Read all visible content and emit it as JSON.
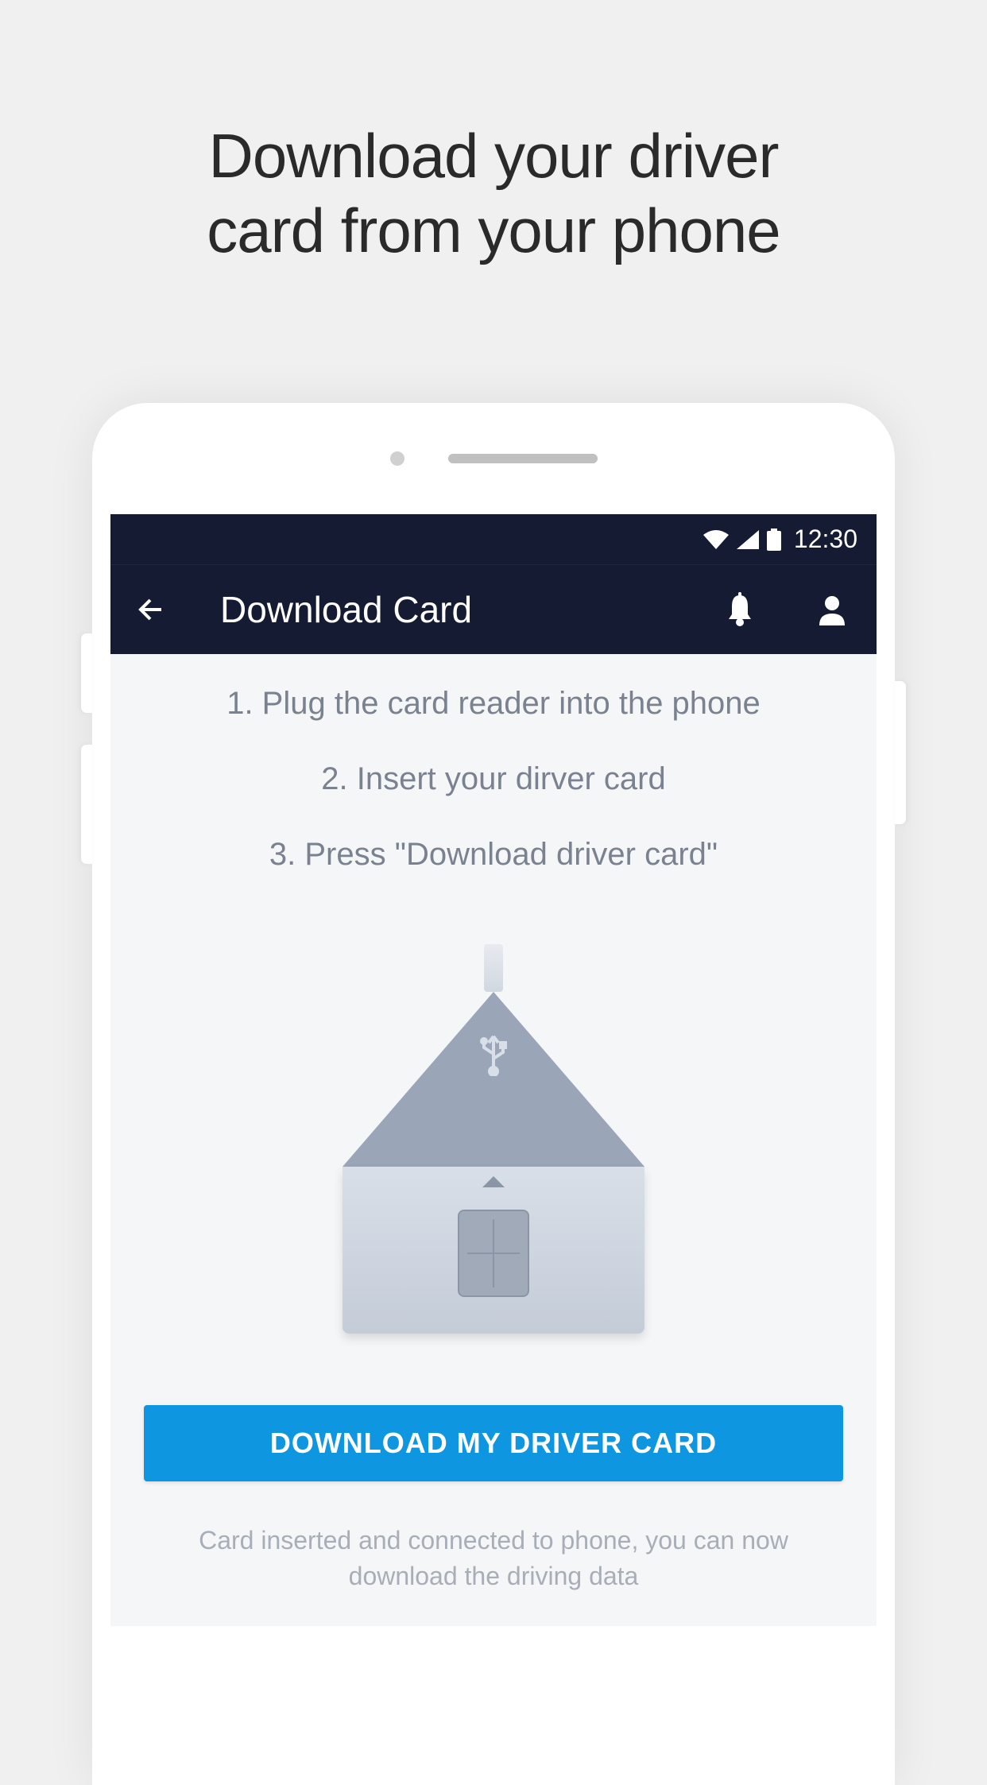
{
  "promo": {
    "title_line1": "Download your driver",
    "title_line2": "card from your phone"
  },
  "status_bar": {
    "time": "12:30"
  },
  "app_bar": {
    "title": "Download Card"
  },
  "instructions": {
    "step1": "1. Plug the card reader into the phone",
    "step2": "2. Insert your dirver card",
    "step3": "3. Press \"Download driver card\""
  },
  "main_action": {
    "button_label": "DOWNLOAD MY DRIVER CARD",
    "status_message": "Card inserted and connected to phone, you can now download the driving data"
  }
}
